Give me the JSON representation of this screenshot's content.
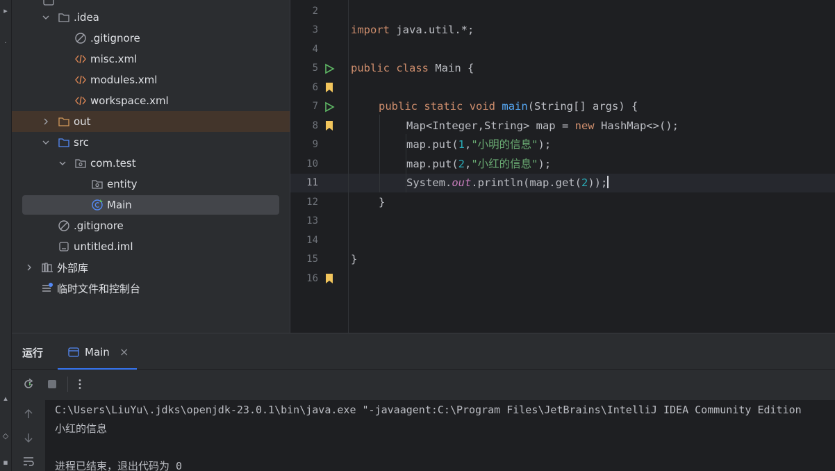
{
  "project_tree": {
    "items": [
      {
        "label": ".idea",
        "icon": "folder-icon",
        "expanded": true
      },
      {
        "label": ".gitignore",
        "icon": "ignore-file-icon"
      },
      {
        "label": "misc.xml",
        "icon": "xml-file-icon"
      },
      {
        "label": "modules.xml",
        "icon": "xml-file-icon"
      },
      {
        "label": "workspace.xml",
        "icon": "xml-file-icon"
      },
      {
        "label": "out",
        "icon": "folder-icon",
        "expanded": false
      },
      {
        "label": "src",
        "icon": "source-folder-icon",
        "expanded": true
      },
      {
        "label": "com.test",
        "icon": "package-icon",
        "expanded": true
      },
      {
        "label": "entity",
        "icon": "package-icon"
      },
      {
        "label": "Main",
        "icon": "java-class-icon",
        "selected": true
      },
      {
        "label": ".gitignore",
        "icon": "ignore-file-icon"
      },
      {
        "label": "untitled.iml",
        "icon": "module-file-icon"
      },
      {
        "label": "外部库",
        "icon": "library-icon",
        "expanded": false
      },
      {
        "label": "临时文件和控制台",
        "icon": "scratches-icon"
      }
    ]
  },
  "editor": {
    "line_numbers": [
      "2",
      "3",
      "4",
      "5",
      "6",
      "7",
      "8",
      "9",
      "10",
      "11",
      "12",
      "13",
      "14",
      "15",
      "16"
    ],
    "current_line": "11",
    "code": {
      "import_kw": "import",
      "import_pkg": " java.util.*;",
      "public": "public",
      "class": "class",
      "class_name": " Main {",
      "static": "static",
      "void": "void",
      "main": "main",
      "main_sig": "(String[] args) {",
      "map_decl_1": "Map<Integer,String> map = ",
      "new": "new",
      "map_decl_2": " HashMap<>();",
      "put": "map.put(",
      "num1": "1",
      "num2": "2",
      "str1": "\"小明的信息\"",
      "str2": "\"小红的信息\"",
      "put_end": ");",
      "comma": ",",
      "sys": "System.",
      "out": "out",
      "println": ".println(map.get(",
      "println_end": "));",
      "close_brace": "}",
      "space": " "
    }
  },
  "run_panel": {
    "title": "运行",
    "tab_label": "Main",
    "tab_close": "×",
    "console_lines": [
      "C:\\Users\\LiuYu\\.jdks\\openjdk-23.0.1\\bin\\java.exe \"-javaagent:C:\\Program Files\\JetBrains\\IntelliJ IDEA Community Edition",
      "小红的信息",
      "",
      "进程已结束，退出代码为 0"
    ]
  },
  "colors": {
    "accent": "#3574f0",
    "keyword": "#cf8e6d",
    "function": "#56a8f5",
    "string": "#6aab73",
    "number": "#2aacb8",
    "field": "#c77dbb",
    "bookmark": "#f2c55c",
    "run_gutter": "#5fb865"
  }
}
